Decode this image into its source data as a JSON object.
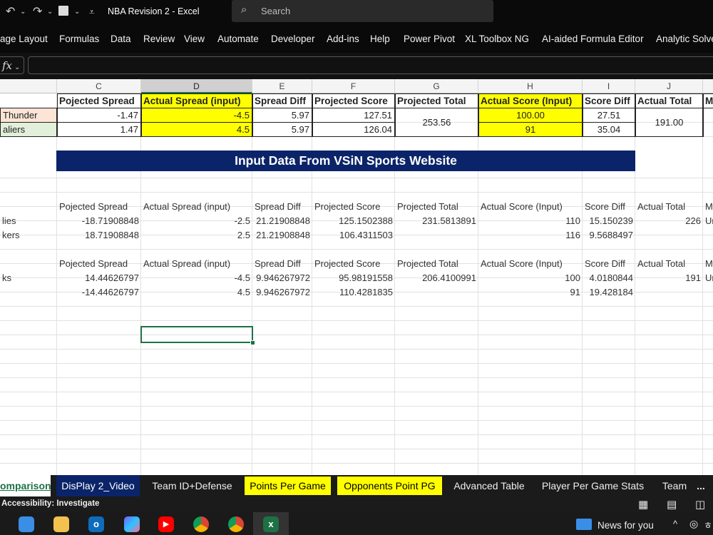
{
  "titlebar": {
    "title": "NBA Revision 2  -  Excel",
    "search_placeholder": "Search"
  },
  "ribbon": {
    "tabs": [
      "age Layout",
      "Formulas",
      "Data",
      "Review",
      "View",
      "Automate",
      "Developer",
      "Add-ins",
      "Help",
      "Power Pivot",
      "XL Toolbox NG",
      "AI-aided Formula Editor",
      "Analytic Solve"
    ]
  },
  "formula_bar": {
    "fx_label": "fx",
    "content": ""
  },
  "columns": [
    "C",
    "D",
    "E",
    "F",
    "G",
    "H",
    "I",
    "J"
  ],
  "table1": {
    "headers": [
      "Pojected Spread",
      "Actual Spread (input)",
      "Spread Diff",
      "Projected Score",
      "Projected Total",
      "Actual Score (Input)",
      "Score Diff",
      "Actual Total",
      "M"
    ],
    "rows": [
      {
        "team": " Thunder",
        "proj_spread": "-1.47",
        "actual_spread": "-4.5",
        "spread_diff": "5.97",
        "proj_score": "127.51",
        "actual_score": "100.00",
        "score_diff": "27.51"
      },
      {
        "team": "aliers",
        "proj_spread": "1.47",
        "actual_spread": "4.5",
        "spread_diff": "5.97",
        "proj_score": "126.04",
        "actual_score": "91",
        "score_diff": "35.04"
      }
    ],
    "projected_total": "253.56",
    "actual_total": "191.00"
  },
  "banner": "Input Data From VSiN Sports Website",
  "table2": {
    "headers": [
      "Pojected Spread",
      "Actual Spread (input)",
      "Spread Diff",
      "Projected Score",
      "Projected Total",
      "Actual Score (Input)",
      "Score Diff",
      "Actual Total",
      "M"
    ],
    "rows": [
      {
        "team": "lies",
        "proj_spread": "-18.71908848",
        "actual_spread": "-2.5",
        "spread_diff": "21.21908848",
        "proj_score": "125.1502388",
        "proj_total": "231.5813891",
        "actual_score": "110",
        "score_diff": "15.150239",
        "actual_total": "226",
        "extra": "Ur"
      },
      {
        "team": "kers",
        "proj_spread": "18.71908848",
        "actual_spread": "2.5",
        "spread_diff": "21.21908848",
        "proj_score": "106.4311503",
        "proj_total": "",
        "actual_score": "116",
        "score_diff": "9.5688497",
        "actual_total": "",
        "extra": ""
      }
    ]
  },
  "table3": {
    "headers": [
      "Pojected Spread",
      "Actual Spread (input)",
      "Spread Diff",
      "Projected Score",
      "Projected Total",
      "Actual Score (Input)",
      "Score Diff",
      "Actual Total",
      "M"
    ],
    "rows": [
      {
        "team": "ks",
        "proj_spread": "14.44626797",
        "actual_spread": "-4.5",
        "spread_diff": "9.946267972",
        "proj_score": "95.98191558",
        "proj_total": "206.4100991",
        "actual_score": "100",
        "score_diff": "4.0180844",
        "actual_total": "191",
        "extra": "Ur"
      },
      {
        "team": "",
        "proj_spread": "-14.44626797",
        "actual_spread": "4.5",
        "spread_diff": "9.946267972",
        "proj_score": "110.4281835",
        "proj_total": "",
        "actual_score": "91",
        "score_diff": "19.428184",
        "actual_total": "",
        "extra": ""
      }
    ]
  },
  "sheet_tabs": [
    "omparison",
    "DisPlay 2_Video",
    "Team ID+Defense",
    "Points Per Game",
    "Opponents Point PG",
    "Advanced Table",
    "Player Per Game Stats",
    "Team",
    "..."
  ],
  "status": {
    "accessibility": "Accessibility: Investigate"
  },
  "taskbar": {
    "news": "News for you"
  },
  "colors": {
    "accent_green": "#1e7145",
    "banner_navy": "#0b2469",
    "input_yellow": "#ffff00"
  }
}
